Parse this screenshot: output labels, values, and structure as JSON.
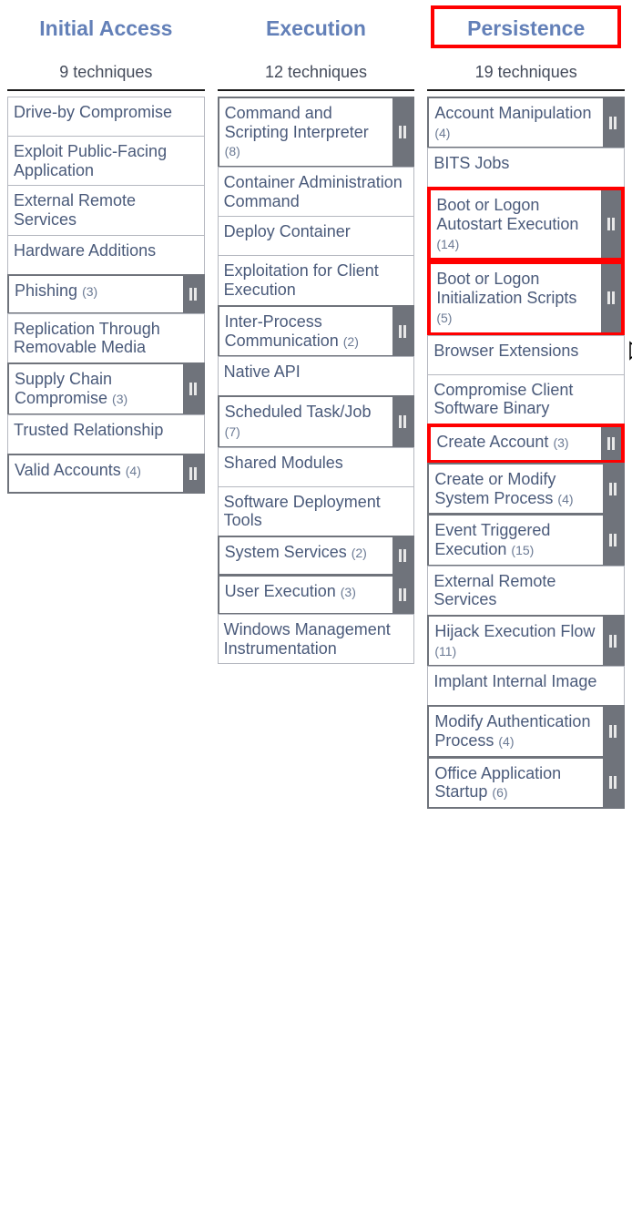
{
  "tactics": [
    {
      "name": "Initial Access",
      "count_label": "9 techniques",
      "highlighted": false,
      "cells": [
        {
          "label": "Drive-by Compromise",
          "count": null,
          "handle": false,
          "hl": false
        },
        {
          "label": "Exploit Public-Facing Application",
          "count": null,
          "handle": false,
          "hl": false
        },
        {
          "label": "External Remote Services",
          "count": null,
          "handle": false,
          "hl": false
        },
        {
          "label": "Hardware Additions",
          "count": null,
          "handle": false,
          "hl": false
        },
        {
          "label": "Phishing",
          "count": "(3)",
          "handle": true,
          "hl": false
        },
        {
          "label": "Replication Through Removable Media",
          "count": null,
          "handle": false,
          "hl": false
        },
        {
          "label": "Supply Chain Compromise",
          "count": "(3)",
          "handle": true,
          "hl": false
        },
        {
          "label": "Trusted Relationship",
          "count": null,
          "handle": false,
          "hl": false
        },
        {
          "label": "Valid Accounts",
          "count": "(4)",
          "handle": true,
          "hl": false
        }
      ]
    },
    {
      "name": "Execution",
      "count_label": "12 techniques",
      "highlighted": false,
      "cells": [
        {
          "label": "Command and Scripting Interpreter",
          "count": "(8)",
          "handle": true,
          "hl": false
        },
        {
          "label": "Container Administration Command",
          "count": null,
          "handle": false,
          "hl": false
        },
        {
          "label": "Deploy Container",
          "count": null,
          "handle": false,
          "hl": false
        },
        {
          "label": "Exploitation for Client Execution",
          "count": null,
          "handle": false,
          "hl": false
        },
        {
          "label": "Inter-Process Communication",
          "count": "(2)",
          "handle": true,
          "hl": false
        },
        {
          "label": "Native API",
          "count": null,
          "handle": false,
          "hl": false
        },
        {
          "label": "Scheduled Task/Job",
          "count": "(7)",
          "handle": true,
          "hl": false
        },
        {
          "label": "Shared Modules",
          "count": null,
          "handle": false,
          "hl": false
        },
        {
          "label": "Software Deployment Tools",
          "count": null,
          "handle": false,
          "hl": false
        },
        {
          "label": "System Services",
          "count": "(2)",
          "handle": true,
          "hl": false
        },
        {
          "label": "User Execution",
          "count": "(3)",
          "handle": true,
          "hl": false
        },
        {
          "label": "Windows Management Instrumentation",
          "count": null,
          "handle": false,
          "hl": false
        }
      ]
    },
    {
      "name": "Persistence",
      "count_label": "19 techniques",
      "highlighted": true,
      "cells": [
        {
          "label": "Account Manipulation",
          "count": "(4)",
          "handle": true,
          "hl": false
        },
        {
          "label": "BITS Jobs",
          "count": null,
          "handle": false,
          "hl": false
        },
        {
          "label": "Boot or Logon Autostart Execution",
          "count": "(14)",
          "handle": true,
          "hl": true
        },
        {
          "label": "Boot or Logon Initialization Scripts",
          "count": "(5)",
          "handle": true,
          "hl": true
        },
        {
          "label": "Browser Extensions",
          "count": null,
          "handle": false,
          "hl": false
        },
        {
          "label": "Compromise Client Software Binary",
          "count": null,
          "handle": false,
          "hl": false
        },
        {
          "label": "Create Account",
          "count": "(3)",
          "handle": true,
          "hl": true
        },
        {
          "label": "Create or Modify System Process",
          "count": "(4)",
          "handle": true,
          "hl": false
        },
        {
          "label": "Event Triggered Execution",
          "count": "(15)",
          "handle": true,
          "hl": false
        },
        {
          "label": "External Remote Services",
          "count": null,
          "handle": false,
          "hl": false
        },
        {
          "label": "Hijack Execution Flow",
          "count": "(11)",
          "handle": true,
          "hl": false
        },
        {
          "label": "Implant Internal Image",
          "count": null,
          "handle": false,
          "hl": false
        },
        {
          "label": "Modify Authentication Process",
          "count": "(4)",
          "handle": true,
          "hl": false
        },
        {
          "label": "Office Application Startup",
          "count": "(6)",
          "handle": true,
          "hl": false
        }
      ]
    }
  ],
  "cursor_glyph": "👆"
}
